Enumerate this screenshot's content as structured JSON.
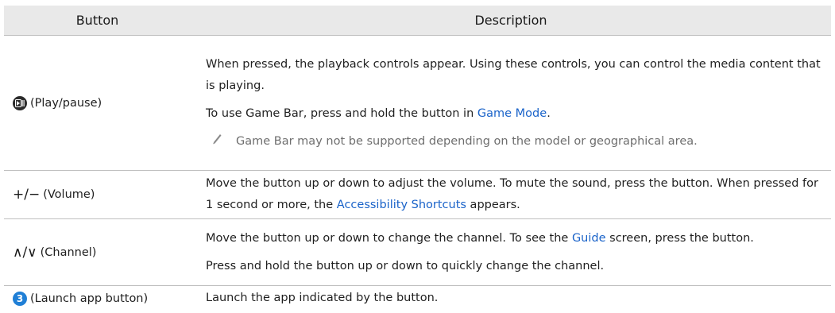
{
  "table": {
    "headers": {
      "button": "Button",
      "description": "Description"
    },
    "rows": [
      {
        "button_icon": "play-pause-icon",
        "button_label": "(Play/pause)",
        "p1": "When pressed, the playback controls appear. Using these controls, you can control the media content that is playing.",
        "p2_before": "To use Game Bar, press and hold the button in ",
        "p2_link": "Game Mode",
        "p2_after": ".",
        "note": "Game Bar may not be supported depending on the model or geographical area."
      },
      {
        "button_icon": "plus-minus-icon",
        "button_symbol": "+/−",
        "button_label": "(Volume)",
        "p1_before": "Move the button up or down to adjust the volume. To mute the sound, press the button. When pressed for 1 second or more, the ",
        "p1_link": "Accessibility Shortcuts",
        "p1_after": " appears."
      },
      {
        "button_icon": "chevron-up-down-icon",
        "button_symbol": "∧/∨",
        "button_label": "(Channel)",
        "p1_before": "Move the button up or down to change the channel. To see the ",
        "p1_link": "Guide",
        "p1_after": " screen, press the button.",
        "p2": "Press and hold the button up or down to quickly change the channel."
      },
      {
        "button_icon": "number-3-icon",
        "button_symbol": "3",
        "button_label": "(Launch app button)",
        "p1": "Launch the app indicated by the button."
      }
    ]
  },
  "colors": {
    "link": "#1a63c9",
    "header_bg": "#e9e9e9",
    "note": "#6e6e6e",
    "badge": "#1f7fd6"
  }
}
